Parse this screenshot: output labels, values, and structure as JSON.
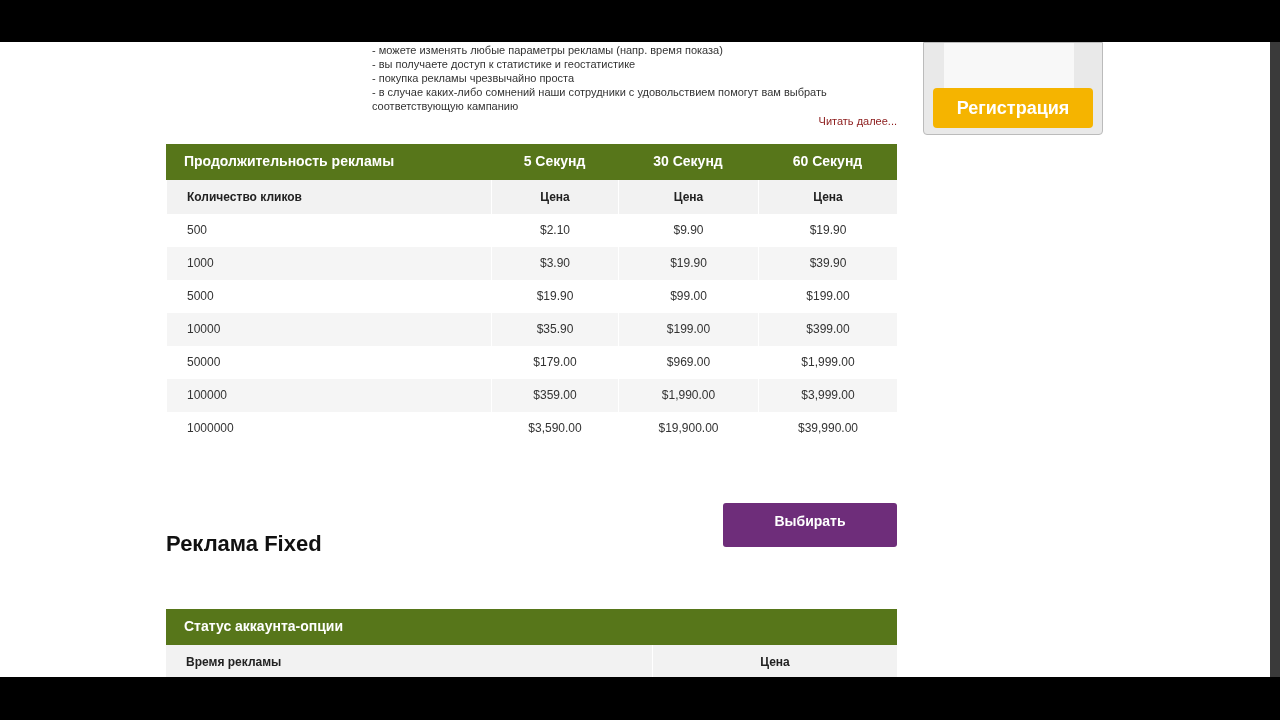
{
  "intro_lines": [
    "- можете изменять любые параметры рекламы (напр. время показа)",
    "- вы получаете доступ к статистике и геостатистике",
    "- покупка рекламы чрезвычайно проста",
    "- в случае каких-либо сомнений наши сотрудники с удовольствием помогут вам выбрать соответствующую кампанию"
  ],
  "read_more": "Читать далее...",
  "banner": {
    "button": "Регистрация"
  },
  "price_table": {
    "columns": [
      "Продолжительность рекламы",
      "5 Секунд",
      "30 Секунд",
      "60 Секунд"
    ],
    "subheader": [
      "Количество кликов",
      "Цена",
      "Цена",
      "Цена"
    ],
    "rows": [
      [
        "500",
        "$2.10",
        "$9.90",
        "$19.90"
      ],
      [
        "1000",
        "$3.90",
        "$19.90",
        "$39.90"
      ],
      [
        "5000",
        "$19.90",
        "$99.00",
        "$199.00"
      ],
      [
        "10000",
        "$35.90",
        "$199.00",
        "$399.00"
      ],
      [
        "50000",
        "$179.00",
        "$969.00",
        "$1,999.00"
      ],
      [
        "100000",
        "$359.00",
        "$1,990.00",
        "$3,999.00"
      ],
      [
        "1000000",
        "$3,590.00",
        "$19,900.00",
        "$39,990.00"
      ]
    ]
  },
  "choose_button": "Выбирать",
  "section_title": "Реклама Fixed",
  "fixed_table": {
    "header": "Статус аккаунта-опции",
    "subheader": [
      "Время рекламы",
      "Цена"
    ]
  }
}
